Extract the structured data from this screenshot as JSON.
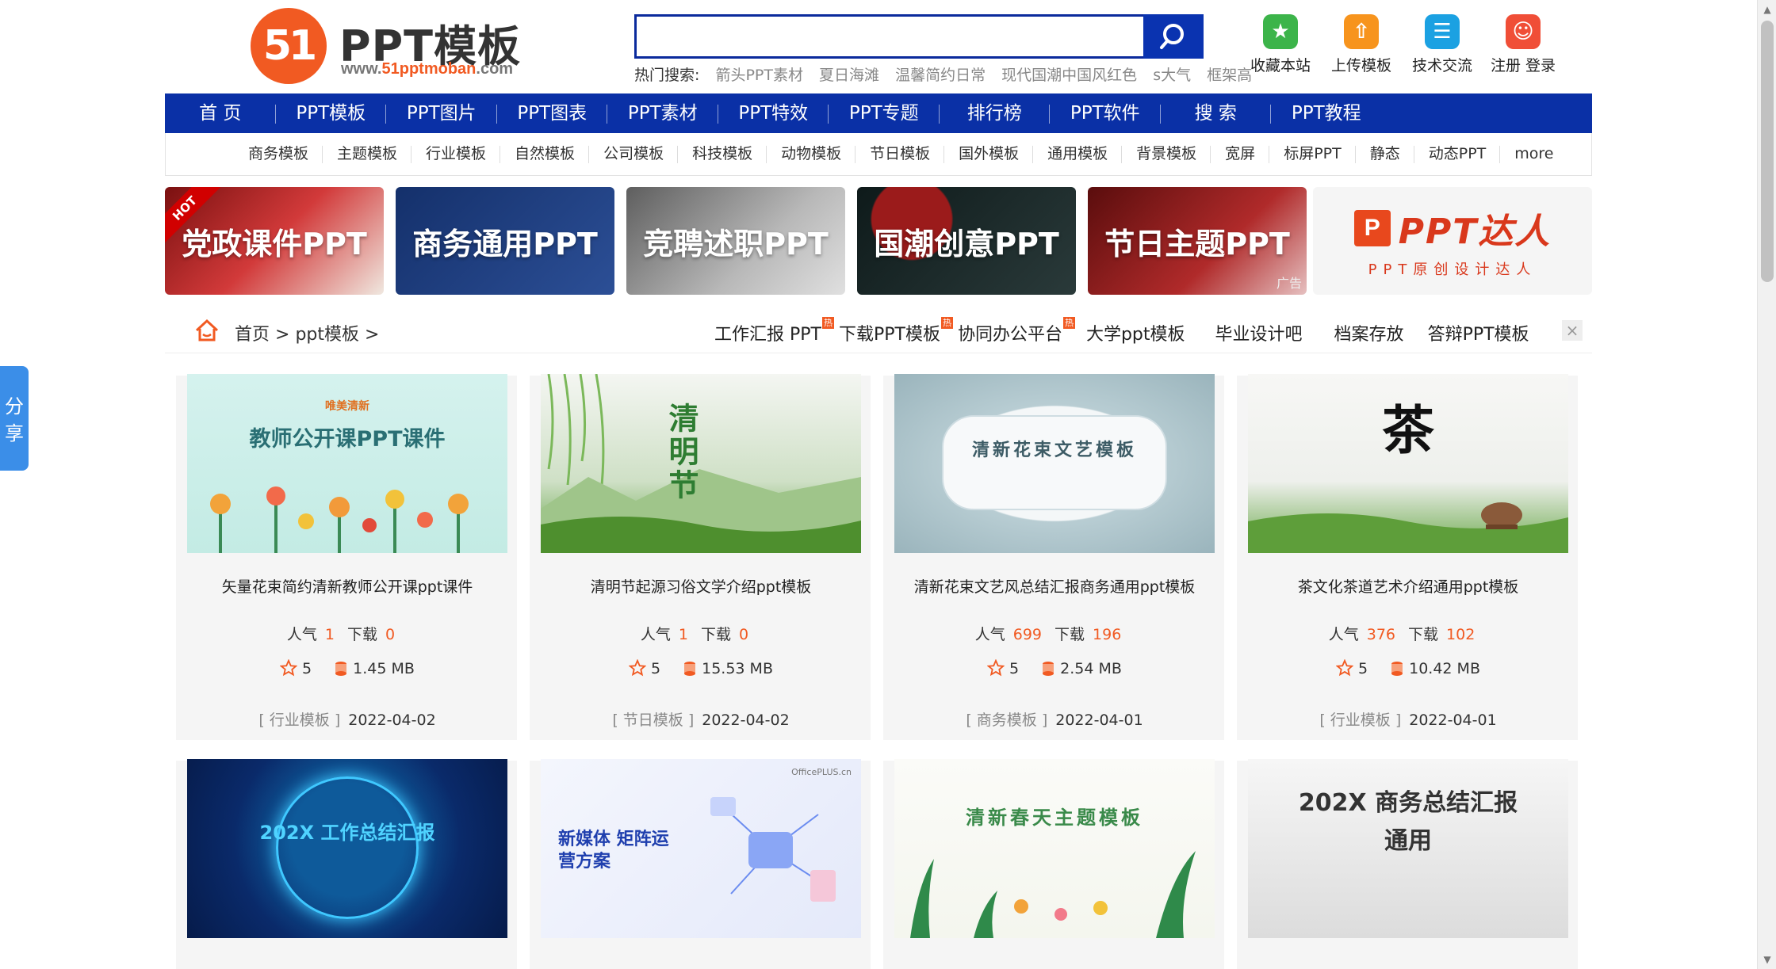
{
  "header": {
    "logo_number": "51",
    "logo_name": "PPT模板",
    "logo_url_prefix": "www.",
    "logo_url_brand": "51pptmoban",
    "logo_url_suffix": ".com",
    "search_placeholder": "",
    "hot_label": "热门搜索:",
    "hot_keywords": [
      "箭头PPT素材",
      "夏日海滩",
      "温馨简约日常",
      "现代国潮中国风红色",
      "s大气",
      "框架高"
    ],
    "tools": [
      {
        "label": "收藏本站",
        "icon": "star-icon",
        "color": "#3cb44a"
      },
      {
        "label": "上传模板",
        "icon": "upload-icon",
        "color": "#f7941d"
      },
      {
        "label": "技术交流",
        "icon": "chat-icon",
        "color": "#1ba1e2"
      },
      {
        "label": "注册 登录",
        "icon": "user-icon",
        "color": "#f04e37"
      }
    ]
  },
  "nav": [
    "首 页",
    "PPT模板",
    "PPT图片",
    "PPT图表",
    "PPT素材",
    "PPT特效",
    "PPT专题",
    "排行榜",
    "PPT软件",
    "搜 索",
    "PPT教程"
  ],
  "subnav": [
    "商务模板",
    "主题模板",
    "行业模板",
    "自然模板",
    "公司模板",
    "科技模板",
    "动物模板",
    "节日模板",
    "国外模板",
    "通用模板",
    "背景模板",
    "宽屏",
    "标屏PPT",
    "静态",
    "动态PPT",
    "more"
  ],
  "banners": [
    {
      "title": "党政课件PPT",
      "badge": "HOT",
      "color": "#b3262a"
    },
    {
      "title": "商务通用PPT",
      "color": "#1e3d7a"
    },
    {
      "title": "竞聘述职PPT",
      "color": "#7a7a7a"
    },
    {
      "title": "国潮创意PPT",
      "color": "#1a2a2a"
    },
    {
      "title": "节日主题PPT",
      "ad": "广告",
      "color": "#8a1f1f"
    },
    {
      "title": "PPT达人",
      "subtitle": "PPT原创设计达人",
      "color": "#d9381c"
    }
  ],
  "breadcrumb": {
    "home": "首页",
    "sep1": ">",
    "current": "ppt模板",
    "sep2": ">"
  },
  "quick_links": [
    {
      "label": "工作汇报 PPT",
      "tag": "热"
    },
    {
      "label": "下载PPT模板",
      "tag": "热"
    },
    {
      "label": "协同办公平台",
      "tag": "热"
    },
    {
      "label": "大学ppt模板"
    },
    {
      "label": "毕业设计吧"
    },
    {
      "label": "档案存放"
    },
    {
      "label": "答辩PPT模板"
    }
  ],
  "close_label": "×",
  "share_label": "分享",
  "stat_labels": {
    "views": "人气",
    "downloads": "下载"
  },
  "cards": [
    {
      "title": "矢量花束简约清新教师公开课ppt课件",
      "views": "1",
      "downloads": "0",
      "rating": "5",
      "size": "1.45 MB",
      "category": "[ 行业模板 ]",
      "date": "2022-04-02",
      "thumb_text": "教师公开课PPT课件",
      "thumb_small": "唯美清新",
      "bg": "#cfeeea",
      "fg": "#2a6f74"
    },
    {
      "title": "清明节起源习俗文学介绍ppt模板",
      "views": "1",
      "downloads": "0",
      "rating": "5",
      "size": "15.53 MB",
      "category": "[ 节日模板 ]",
      "date": "2022-04-02",
      "thumb_text": "清明节",
      "bg": "#e6ede2",
      "fg": "#2e7d32"
    },
    {
      "title": "清新花束文艺风总结汇报商务通用ppt模板",
      "views": "699",
      "downloads": "196",
      "rating": "5",
      "size": "2.54 MB",
      "category": "[ 商务模板 ]",
      "date": "2022-04-01",
      "thumb_text": "清新花束文艺模板",
      "bg": "#d6e3e6",
      "fg": "#3d5c66"
    },
    {
      "title": "茶文化茶道艺术介绍通用ppt模板",
      "views": "376",
      "downloads": "102",
      "rating": "5",
      "size": "10.42 MB",
      "category": "[ 行业模板 ]",
      "date": "2022-04-01",
      "thumb_text": "茶",
      "bg": "#f3f3f1",
      "fg": "#111"
    },
    {
      "title": "",
      "thumb_text": "202X 工作总结汇报",
      "bg": "#0a2a6a",
      "fg": "#4fd3ff"
    },
    {
      "title": "",
      "thumb_text": "新媒体 矩阵运营方案",
      "thumb_small": "OfficePLUS.cn",
      "bg": "#eef1fb",
      "fg": "#1f3fae"
    },
    {
      "title": "",
      "thumb_text": "清新春天主题模板",
      "bg": "#f6f7f2",
      "fg": "#3a8a4a"
    },
    {
      "title": "",
      "thumb_text": "202X 商务总结汇报通用",
      "bg": "#f0f0f0",
      "fg": "#333"
    }
  ]
}
